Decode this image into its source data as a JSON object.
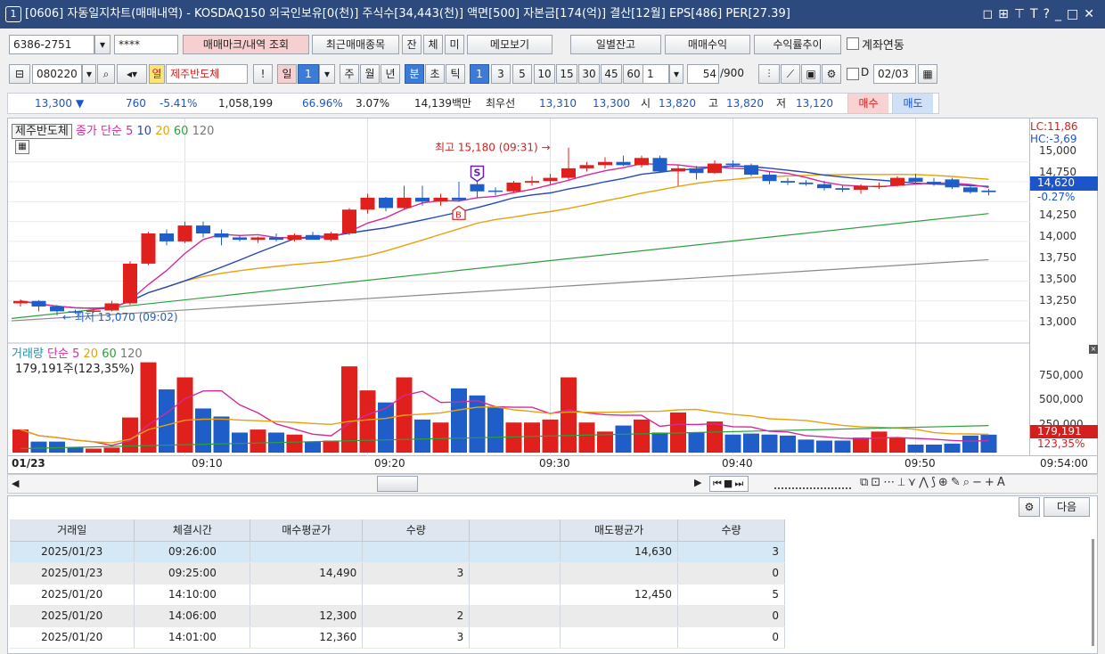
{
  "title": {
    "num": "1",
    "text": "[0606] 자동일지차트(매매내역) - KOSDAQ150 외국인보유[0(천)] 주식수[34,443(천)] 액면[500] 자본금[174(억)] 결산[12월] EPS[486] PER[27.39]"
  },
  "toolbar1": {
    "account": "6386-2751",
    "password": "****",
    "btn_mark": "매매마크/내역 조회",
    "btn_recent": "최근매매종목",
    "btn_jan": "잔",
    "btn_che": "체",
    "btn_mi": "미",
    "btn_memo": "메모보기",
    "btn_daily": "일별잔고",
    "btn_profit": "매매수익",
    "btn_rate": "수익률추이",
    "chk_account": "계좌연동"
  },
  "toolbar2": {
    "code": "080220",
    "hangul": "열",
    "stock_name": "제주반도체",
    "excl": "!",
    "period": [
      "일",
      "1",
      "주",
      "월",
      "년",
      "분",
      "초",
      "틱"
    ],
    "periods_num": [
      "1",
      "3",
      "5",
      "10",
      "15",
      "30",
      "45",
      "60"
    ],
    "count_val": "1",
    "bars": "54",
    "bars_total": "/900",
    "d_label": "D",
    "date": "02/03"
  },
  "quote": {
    "price": "13,300",
    "arrow": "▼",
    "change": "760",
    "pct": "-5.41%",
    "volume": "1,058,199",
    "vol_ratio": "66.96%",
    "turn": "3.07%",
    "amount": "14,139백만",
    "best_label": "최우선",
    "bid": "13,310",
    "ask": "13,300",
    "open_label": "시",
    "open": "13,820",
    "high_label": "고",
    "high": "13,820",
    "low_label": "저",
    "low": "13,120",
    "buy": "매수",
    "sell": "매도"
  },
  "chart": {
    "stock": "제주반도체",
    "legend_close": "종가",
    "legend_ma": "단순",
    "ma": [
      "5",
      "10",
      "20",
      "60",
      "120"
    ],
    "high_note": "최고 15,180 (09:31)",
    "low_note": "최저 13,070 (09:02)",
    "lc": "LC:11,86",
    "hc": "HC:-3,69",
    "cur_price": "14,620",
    "cur_pct": "-0.27%",
    "y_ticks": [
      "15,000",
      "14,750",
      "14,500",
      "14,250",
      "14,000",
      "13,750",
      "13,500",
      "13,250",
      "13,000"
    ],
    "vol_legend": "거래량",
    "vol_ma_label": "단순",
    "vol_ma": [
      "5",
      "20",
      "60",
      "120"
    ],
    "vol_now": "179,191주(123,35%)",
    "vol_ticks": [
      "750,000",
      "500,000",
      "250,000"
    ],
    "vol_cur": "179,191",
    "vol_cur_pct": "123,35%",
    "marker_s": "S",
    "marker_b": "B"
  },
  "xaxis": {
    "date": "01/23",
    "ticks": [
      "09:10",
      "09:20",
      "09:30",
      "09:40",
      "09:50"
    ],
    "end": "09:54:00"
  },
  "grid_controls": {
    "next": "다음"
  },
  "table": {
    "headers": [
      "거래일",
      "체결시간",
      "매수평균가",
      "수량",
      "",
      "매도평균가",
      "수량"
    ],
    "rows": [
      [
        "2025/01/23",
        "09:26:00",
        "",
        "",
        "",
        "14,630",
        "3"
      ],
      [
        "2025/01/23",
        "09:25:00",
        "14,490",
        "3",
        "",
        "",
        "0"
      ],
      [
        "2025/01/20",
        "14:10:00",
        "",
        "",
        "",
        "12,450",
        "5"
      ],
      [
        "2025/01/20",
        "14:06:00",
        "12,300",
        "2",
        "",
        "",
        "0"
      ],
      [
        "2025/01/20",
        "14:01:00",
        "12,360",
        "3",
        "",
        "",
        "0"
      ]
    ]
  },
  "chart_data": {
    "type": "candlestick",
    "x": [
      "09:01",
      "09:02",
      "09:03",
      "09:04",
      "09:05",
      "09:06",
      "09:07",
      "09:08",
      "09:09",
      "09:10",
      "09:11",
      "09:12",
      "09:13",
      "09:14",
      "09:15",
      "09:16",
      "09:17",
      "09:18",
      "09:19",
      "09:20",
      "09:21",
      "09:22",
      "09:23",
      "09:24",
      "09:25",
      "09:26",
      "09:27",
      "09:28",
      "09:29",
      "09:30",
      "09:31",
      "09:32",
      "09:33",
      "09:34",
      "09:35",
      "09:36",
      "09:37",
      "09:38",
      "09:39",
      "09:40",
      "09:41",
      "09:42",
      "09:43",
      "09:44",
      "09:45",
      "09:46",
      "09:47",
      "09:48",
      "09:49",
      "09:50",
      "09:51",
      "09:52",
      "09:53",
      "09:54"
    ],
    "candles": [
      [
        13220,
        13270,
        13180,
        13250
      ],
      [
        13250,
        13260,
        13120,
        13180
      ],
      [
        13180,
        13200,
        13070,
        13120
      ],
      [
        13120,
        13140,
        13090,
        13110
      ],
      [
        13120,
        13150,
        13100,
        13130
      ],
      [
        13130,
        13250,
        13120,
        13220
      ],
      [
        13220,
        13750,
        13200,
        13720
      ],
      [
        13720,
        14120,
        13700,
        14100
      ],
      [
        14100,
        14150,
        13950,
        14000
      ],
      [
        14000,
        14250,
        13980,
        14200
      ],
      [
        14200,
        14250,
        14050,
        14100
      ],
      [
        14100,
        14150,
        13950,
        14050
      ],
      [
        14050,
        14080,
        14000,
        14020
      ],
      [
        14020,
        14060,
        13980,
        14050
      ],
      [
        14050,
        14100,
        14000,
        14020
      ],
      [
        14020,
        14100,
        14000,
        14080
      ],
      [
        14080,
        14120,
        14020,
        14020
      ],
      [
        14020,
        14120,
        14000,
        14100
      ],
      [
        14100,
        14420,
        14080,
        14400
      ],
      [
        14400,
        14600,
        14350,
        14550
      ],
      [
        14550,
        14560,
        14380,
        14420
      ],
      [
        14420,
        14700,
        14400,
        14550
      ],
      [
        14550,
        14700,
        14450,
        14500
      ],
      [
        14500,
        14600,
        14450,
        14550
      ],
      [
        14550,
        14750,
        14500,
        14520
      ],
      [
        14720,
        14800,
        14550,
        14630
      ],
      [
        14640,
        14680,
        14580,
        14630
      ],
      [
        14630,
        14760,
        14620,
        14740
      ],
      [
        14740,
        14820,
        14700,
        14760
      ],
      [
        14760,
        14850,
        14720,
        14800
      ],
      [
        14800,
        15180,
        14780,
        14920
      ],
      [
        14920,
        15000,
        14880,
        14960
      ],
      [
        14960,
        15060,
        14920,
        15000
      ],
      [
        15000,
        15080,
        14950,
        14960
      ],
      [
        14960,
        15080,
        14930,
        15050
      ],
      [
        15050,
        15080,
        14860,
        14880
      ],
      [
        14880,
        14960,
        14700,
        14920
      ],
      [
        14920,
        14950,
        14780,
        14860
      ],
      [
        14860,
        15020,
        14850,
        14980
      ],
      [
        14980,
        15020,
        14930,
        14960
      ],
      [
        14960,
        14980,
        14820,
        14840
      ],
      [
        14840,
        14880,
        14720,
        14760
      ],
      [
        14760,
        14800,
        14710,
        14740
      ],
      [
        14740,
        14770,
        14700,
        14720
      ],
      [
        14720,
        14760,
        14640,
        14670
      ],
      [
        14670,
        14700,
        14620,
        14650
      ],
      [
        14650,
        14720,
        14600,
        14700
      ],
      [
        14700,
        14740,
        14660,
        14700
      ],
      [
        14700,
        14820,
        14690,
        14800
      ],
      [
        14800,
        14850,
        14730,
        14750
      ],
      [
        14750,
        14800,
        14700,
        14730
      ],
      [
        14780,
        14800,
        14660,
        14680
      ],
      [
        14680,
        14700,
        14600,
        14620
      ],
      [
        14640,
        14660,
        14580,
        14620
      ]
    ],
    "volume": [
      230000,
      110000,
      110000,
      50000,
      40000,
      50000,
      350000,
      900000,
      630000,
      750000,
      440000,
      360000,
      200000,
      230000,
      200000,
      180000,
      110000,
      120000,
      860000,
      620000,
      500000,
      750000,
      330000,
      300000,
      640000,
      570000,
      450000,
      300000,
      300000,
      330000,
      750000,
      300000,
      210000,
      270000,
      330000,
      200000,
      400000,
      200000,
      310000,
      180000,
      190000,
      180000,
      170000,
      130000,
      120000,
      120000,
      150000,
      210000,
      150000,
      80000,
      80000,
      90000,
      170000,
      179191
    ],
    "ylim": [
      12900,
      15300
    ],
    "vol_ylim": [
      0,
      950000
    ]
  }
}
